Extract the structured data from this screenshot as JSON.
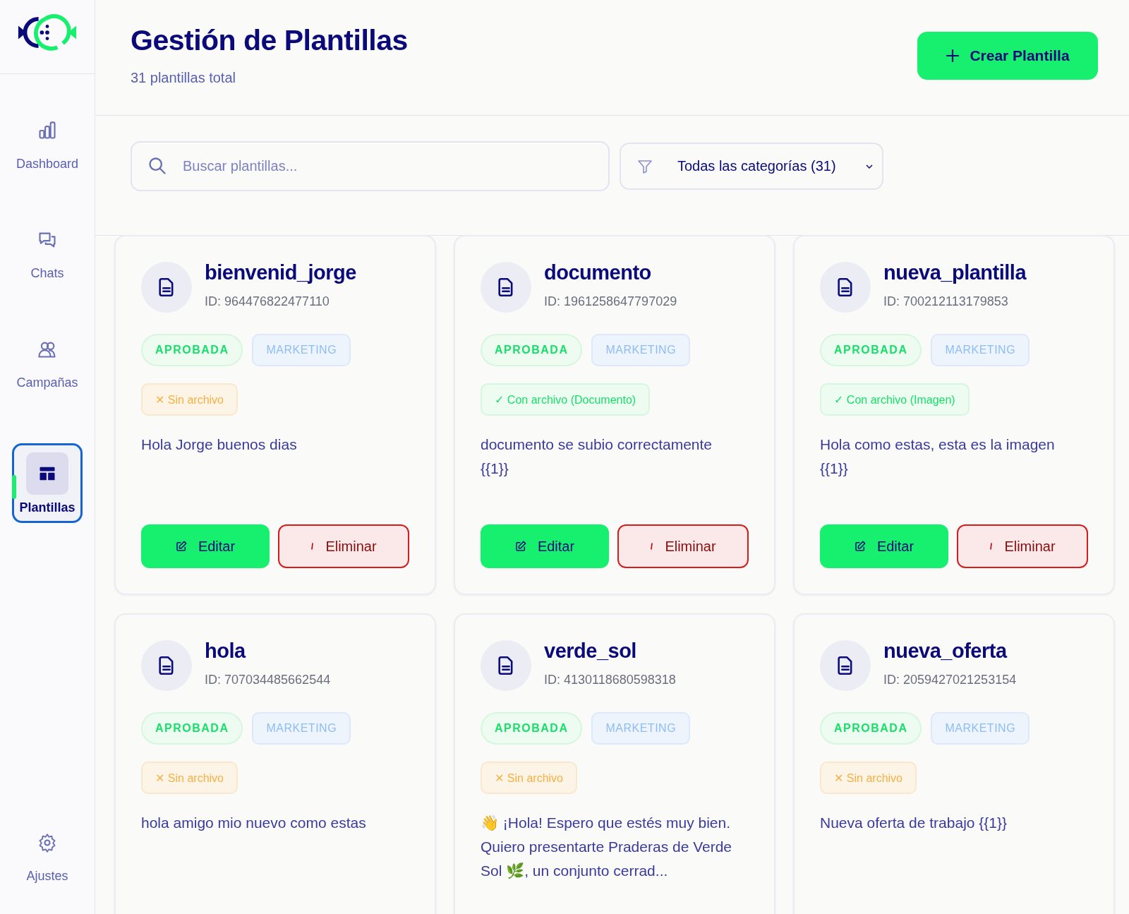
{
  "sidebar": {
    "items": [
      {
        "label": "Dashboard",
        "selected": false
      },
      {
        "label": "Chats",
        "selected": false
      },
      {
        "label": "Campañas",
        "selected": false
      },
      {
        "label": "Plantillas",
        "selected": true
      }
    ],
    "footer_item": {
      "label": "Ajustes",
      "selected": false
    }
  },
  "header": {
    "title": "Gestión de Plantillas",
    "subtitle": "31 plantillas total",
    "create_button": "Crear Plantilla"
  },
  "search": {
    "placeholder": "Buscar plantillas..."
  },
  "category_filter": {
    "value": "Todas las categorías (31)"
  },
  "templates": [
    {
      "name": "bienvenid_jorge",
      "id": "ID: 964476822477110",
      "status": "APROBADA",
      "category": "MARKETING",
      "file": {
        "kind": "missing",
        "label": "✕ Sin archivo"
      },
      "body": "Hola Jorge buenos dias",
      "actions": [
        "Editar",
        "Eliminar"
      ]
    },
    {
      "name": "documento",
      "id": "ID: 1961258647797029",
      "status": "APROBADA",
      "category": "MARKETING",
      "file": {
        "kind": "attached",
        "label": "✓ Con archivo (Documento)"
      },
      "body": "documento se subio correctamente {{1}}",
      "actions": [
        "Editar",
        "Eliminar"
      ]
    },
    {
      "name": "nueva_plantilla",
      "id": "ID: 700212113179853",
      "status": "APROBADA",
      "category": "MARKETING",
      "file": {
        "kind": "attached",
        "label": "✓ Con archivo (Imagen)"
      },
      "body": "Hola como estas, esta es la imagen {{1}}",
      "actions": [
        "Editar",
        "Eliminar"
      ]
    },
    {
      "name": "hola",
      "id": "ID: 707034485662544",
      "status": "APROBADA",
      "category": "MARKETING",
      "file": {
        "kind": "missing",
        "label": "✕ Sin archivo"
      },
      "body": "hola amigo mio nuevo como estas"
    },
    {
      "name": "verde_sol",
      "id": "ID: 4130118680598318",
      "status": "APROBADA",
      "category": "MARKETING",
      "file": {
        "kind": "missing",
        "label": "✕ Sin archivo"
      },
      "body": "👋 ¡Hola! Espero que estés muy bien. Quiero presentarte Praderas de Verde Sol 🌿, un conjunto cerrad..."
    },
    {
      "name": "nueva_oferta",
      "id": "ID: 2059427021253154",
      "status": "APROBADA",
      "category": "MARKETING",
      "file": {
        "kind": "missing",
        "label": "✕ Sin archivo"
      },
      "body": "Nueva oferta de trabajo {{1}}"
    }
  ]
}
